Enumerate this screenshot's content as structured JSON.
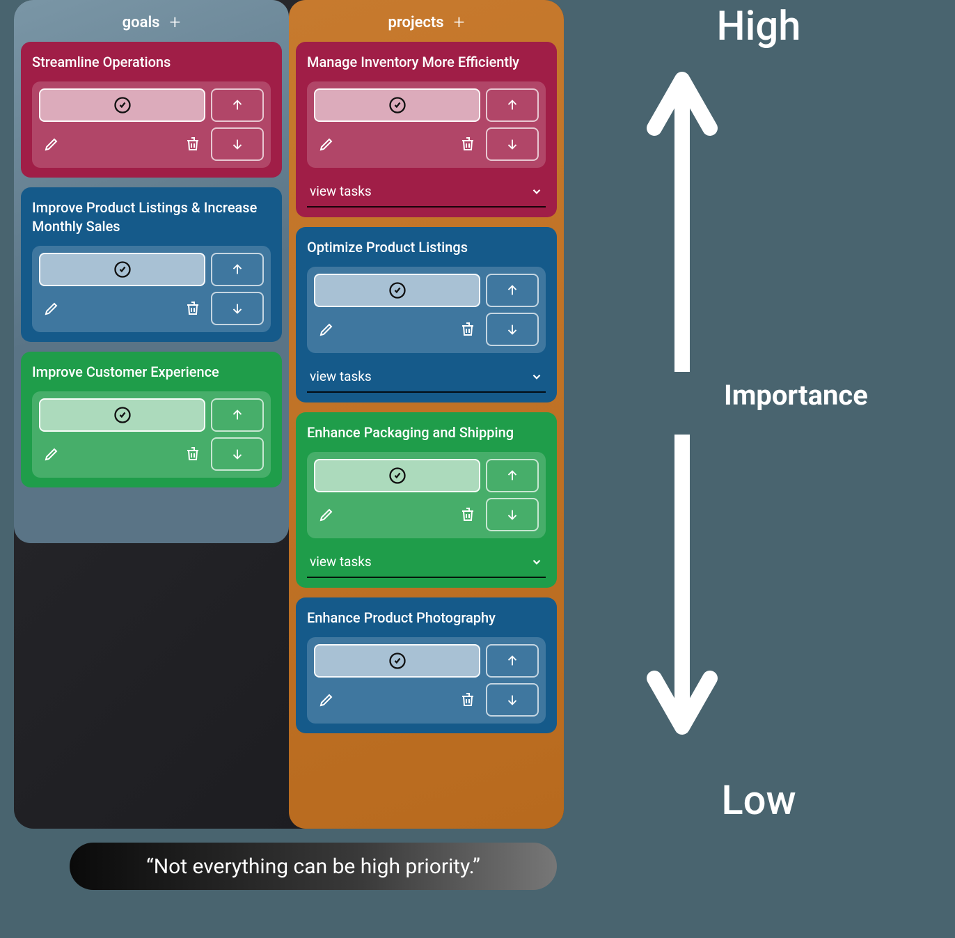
{
  "columns": {
    "goals": {
      "header": "goals",
      "cards": [
        {
          "title": "Streamline Operations",
          "color": "red",
          "has_view_tasks": false
        },
        {
          "title": "Improve Product Listings & Increase Monthly Sales",
          "color": "blue",
          "has_view_tasks": false
        },
        {
          "title": "Improve Customer Experience",
          "color": "green",
          "has_view_tasks": false
        }
      ]
    },
    "projects": {
      "header": "projects",
      "cards": [
        {
          "title": "Manage Inventory More Efficiently",
          "color": "red",
          "has_view_tasks": true
        },
        {
          "title": "Optimize Product Listings",
          "color": "blue",
          "has_view_tasks": true
        },
        {
          "title": "Enhance Packaging and Shipping",
          "color": "green",
          "has_view_tasks": true
        },
        {
          "title": "Enhance Product Photography",
          "color": "blue",
          "has_view_tasks": true
        }
      ]
    }
  },
  "view_tasks_label": "view tasks",
  "axis": {
    "high": "High",
    "low": "Low",
    "label": "Importance"
  },
  "quote": "“Not everything can be high priority.”",
  "icons": {
    "plus": "plus-icon",
    "complete": "check-circle-icon",
    "up": "arrow-up-icon",
    "down": "arrow-down-icon",
    "edit": "pencil-icon",
    "delete": "trash-icon",
    "chevron": "chevron-down-icon"
  },
  "colors": {
    "red": "#a01e47",
    "blue": "#155a8a",
    "green": "#1f9d4a",
    "board_bg": "#1e1e22",
    "page_bg": "#49646f"
  }
}
